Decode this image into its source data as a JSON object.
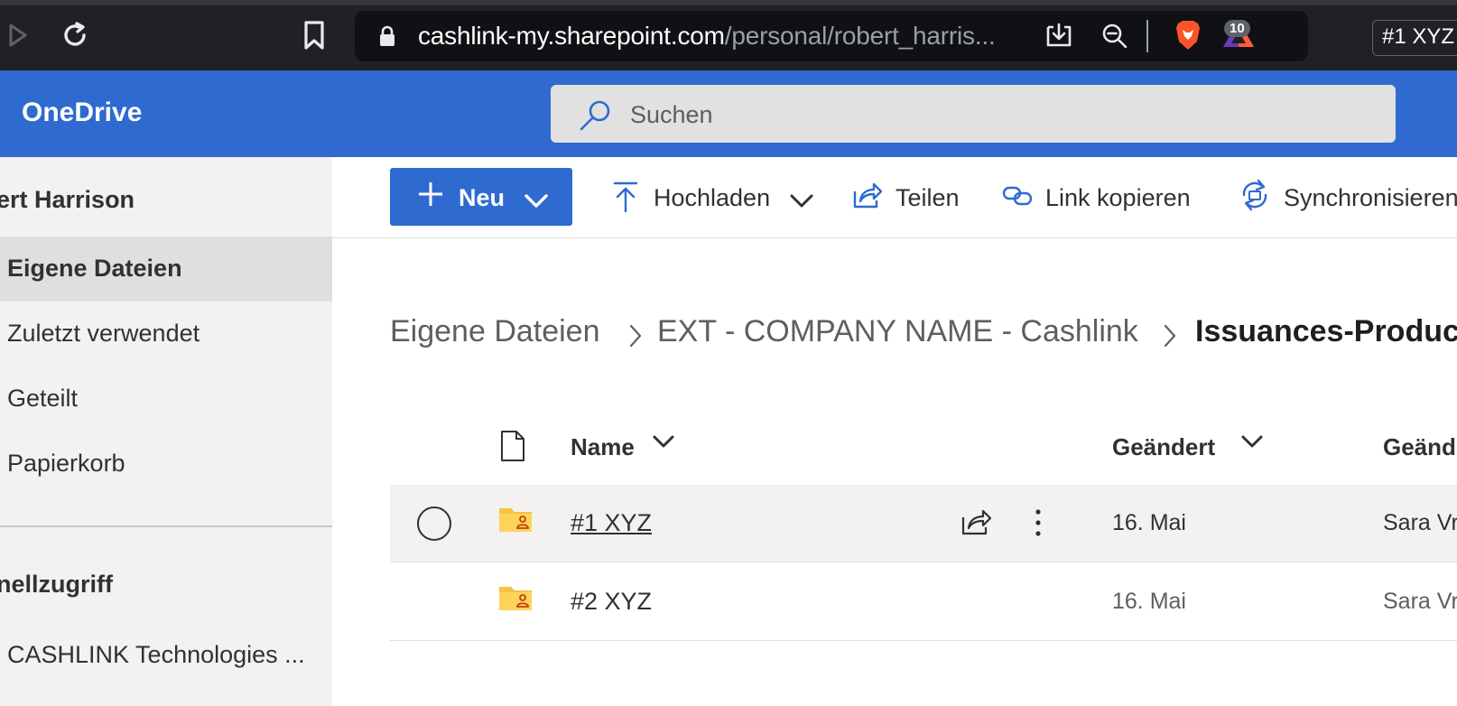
{
  "browser": {
    "url_host": "cashlink-my.sharepoint.com",
    "url_path": "/personal/robert_harris...",
    "extension_badge": "10",
    "tab_title": "#1 XYZ"
  },
  "header": {
    "brand": "OneDrive",
    "search_placeholder": "Suchen",
    "accent": "#2e6ad0"
  },
  "sidebar": {
    "user_name": "ert Harrison",
    "items": [
      {
        "label": "Eigene Dateien",
        "active": true
      },
      {
        "label": "Zuletzt verwendet",
        "active": false
      },
      {
        "label": "Geteilt",
        "active": false
      },
      {
        "label": "Papierkorb",
        "active": false
      }
    ],
    "quick_access_heading": "nellzugriff",
    "quick_access_items": [
      {
        "label": "CASHLINK Technologies ..."
      }
    ]
  },
  "commandbar": {
    "new_label": "Neu",
    "upload_label": "Hochladen",
    "share_label": "Teilen",
    "copy_link_label": "Link kopieren",
    "sync_label": "Synchronisieren"
  },
  "breadcrumb": [
    {
      "label": "Eigene Dateien"
    },
    {
      "label": "EXT - COMPANY NAME - Cashlink"
    },
    {
      "label": "Issuances-Product"
    }
  ],
  "list": {
    "columns": {
      "name": "Name",
      "modified": "Geändert",
      "modified_by": "Geänd"
    },
    "rows": [
      {
        "name": "#1 XYZ",
        "modified": "16. Mai",
        "modified_by": "Sara Vr",
        "selected": true
      },
      {
        "name": "#2 XYZ",
        "modified": "16. Mai",
        "modified_by": "Sara Vr",
        "selected": false
      }
    ]
  }
}
